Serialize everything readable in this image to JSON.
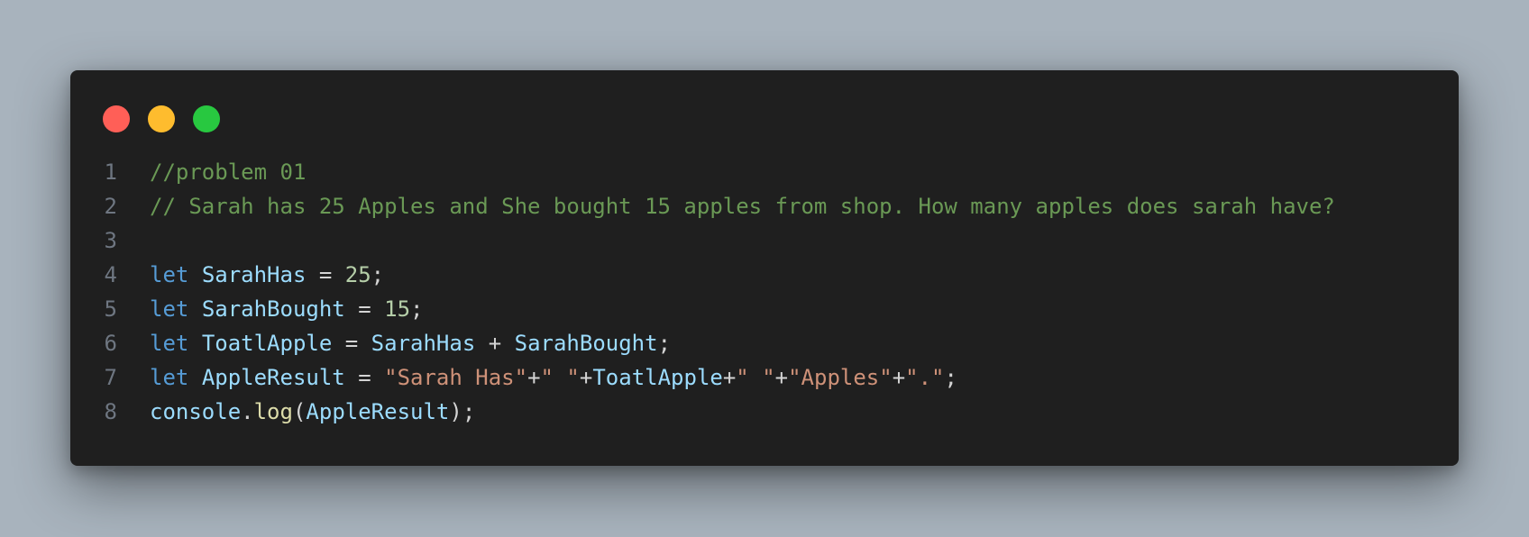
{
  "colors": {
    "background": "#a8b3bd",
    "window": "#1f1f1f",
    "close": "#ff5f57",
    "minimize": "#febc2e",
    "maximize": "#28c840",
    "line_number": "#6e7681",
    "comment": "#6a9955",
    "keyword": "#569cd6",
    "variable": "#9cdcfe",
    "number": "#b5cea8",
    "string": "#ce9178",
    "function": "#dcdcaa",
    "default": "#d4d4d4"
  },
  "window_controls": [
    {
      "name": "close",
      "icon": "close-dot-icon"
    },
    {
      "name": "minimize",
      "icon": "minimize-dot-icon"
    },
    {
      "name": "maximize",
      "icon": "maximize-dot-icon"
    }
  ],
  "code": {
    "lines": [
      {
        "number": "1",
        "tokens": [
          {
            "t": "comment",
            "v": "//problem 01"
          }
        ]
      },
      {
        "number": "2",
        "tokens": [
          {
            "t": "comment",
            "v": "// Sarah has 25 Apples and She bought 15 apples from shop. How many apples does sarah have?"
          }
        ]
      },
      {
        "number": "3",
        "tokens": []
      },
      {
        "number": "4",
        "tokens": [
          {
            "t": "keyword",
            "v": "let"
          },
          {
            "t": "op",
            "v": " "
          },
          {
            "t": "var",
            "v": "SarahHas"
          },
          {
            "t": "op",
            "v": " = "
          },
          {
            "t": "number",
            "v": "25"
          },
          {
            "t": "op",
            "v": ";"
          }
        ]
      },
      {
        "number": "5",
        "tokens": [
          {
            "t": "keyword",
            "v": "let"
          },
          {
            "t": "op",
            "v": " "
          },
          {
            "t": "var",
            "v": "SarahBought"
          },
          {
            "t": "op",
            "v": " = "
          },
          {
            "t": "number",
            "v": "15"
          },
          {
            "t": "op",
            "v": ";"
          }
        ]
      },
      {
        "number": "6",
        "tokens": [
          {
            "t": "keyword",
            "v": "let"
          },
          {
            "t": "op",
            "v": " "
          },
          {
            "t": "var",
            "v": "ToatlApple"
          },
          {
            "t": "op",
            "v": " = "
          },
          {
            "t": "var",
            "v": "SarahHas"
          },
          {
            "t": "op",
            "v": " + "
          },
          {
            "t": "var",
            "v": "SarahBought"
          },
          {
            "t": "op",
            "v": ";"
          }
        ]
      },
      {
        "number": "7",
        "tokens": [
          {
            "t": "keyword",
            "v": "let"
          },
          {
            "t": "op",
            "v": " "
          },
          {
            "t": "var",
            "v": "AppleResult"
          },
          {
            "t": "op",
            "v": " = "
          },
          {
            "t": "string",
            "v": "\"Sarah Has\""
          },
          {
            "t": "op",
            "v": "+"
          },
          {
            "t": "string",
            "v": "\" \""
          },
          {
            "t": "op",
            "v": "+"
          },
          {
            "t": "var",
            "v": "ToatlApple"
          },
          {
            "t": "op",
            "v": "+"
          },
          {
            "t": "string",
            "v": "\" \""
          },
          {
            "t": "op",
            "v": "+"
          },
          {
            "t": "string",
            "v": "\"Apples\""
          },
          {
            "t": "op",
            "v": "+"
          },
          {
            "t": "string",
            "v": "\".\""
          },
          {
            "t": "op",
            "v": ";"
          }
        ]
      },
      {
        "number": "8",
        "tokens": [
          {
            "t": "var",
            "v": "console"
          },
          {
            "t": "op",
            "v": "."
          },
          {
            "t": "func",
            "v": "log"
          },
          {
            "t": "op",
            "v": "("
          },
          {
            "t": "var",
            "v": "AppleResult"
          },
          {
            "t": "op",
            "v": ");"
          }
        ]
      }
    ]
  }
}
